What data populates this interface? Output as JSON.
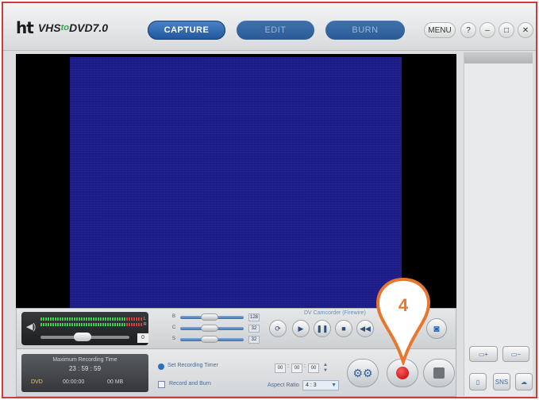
{
  "app": {
    "logo_mark": "ht",
    "logo_text": "VHS",
    "logo_to": "to",
    "logo_dvd": "DVD",
    "logo_version": "7.0"
  },
  "tabs": [
    {
      "label": "CAPTURE",
      "active": true
    },
    {
      "label": "EDIT",
      "active": false
    },
    {
      "label": "BURN",
      "active": false
    }
  ],
  "window": {
    "menu_label": "MENU",
    "help_label": "?",
    "minimize_label": "–",
    "maximize_label": "□",
    "close_label": "✕"
  },
  "audio": {
    "speaker_icon": "speaker-icon",
    "left_label": "L",
    "right_label": "R",
    "volume_value": "0"
  },
  "adjust": [
    {
      "label": "B",
      "value": "128"
    },
    {
      "label": "C",
      "value": "32"
    },
    {
      "label": "S",
      "value": "32"
    }
  ],
  "device": {
    "label": "DV Camcorder (Firewire)"
  },
  "transport": {
    "refresh": "⟳",
    "play": "▶",
    "pause": "❚❚",
    "stop": "■",
    "rewind": "◀◀",
    "snapshot_icon": "camera-icon"
  },
  "recording": {
    "title": "Maximum Recording Time",
    "max_time": "23 : 59 : 59",
    "format": "DVD",
    "elapsed": "00:00:00",
    "size": "00 MB"
  },
  "options": {
    "timer_label": "Set Recording Timer",
    "burn_label": "Record and Burn",
    "timer": [
      "00",
      "00",
      "00"
    ],
    "aspect_label": "Aspect Ratio",
    "aspect_value": "4 : 3"
  },
  "side": {
    "add_label": "▭+",
    "remove_label": "▭−",
    "phone_label": "▯",
    "sns_label": "SNS",
    "cloud_label": "☁"
  },
  "callout": {
    "number": "4",
    "color": "#e8772e"
  },
  "colors": {
    "accent": "#2b6fc2",
    "record": "#d00000",
    "frame": "#d23a3a"
  }
}
